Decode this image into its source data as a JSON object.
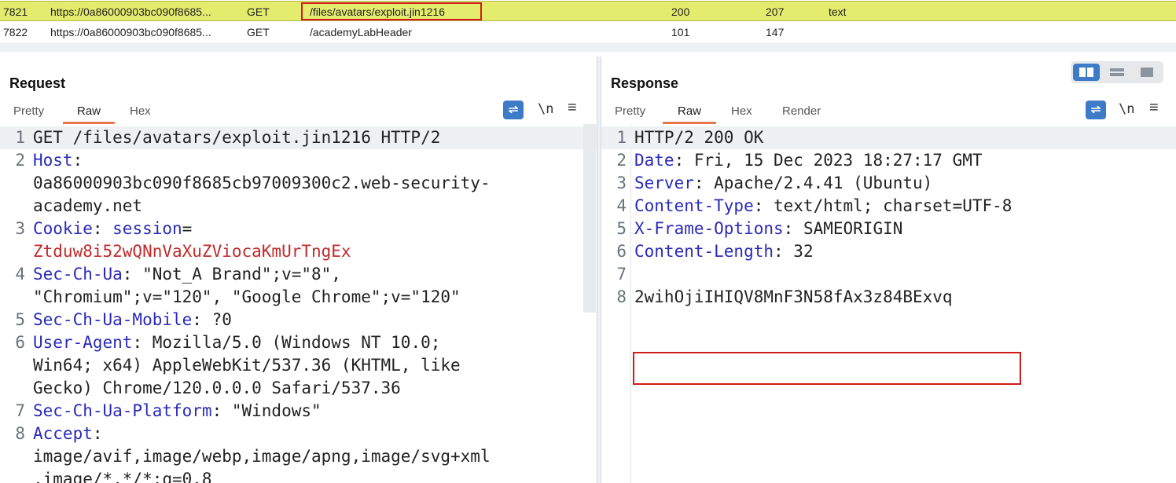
{
  "history": {
    "rows": [
      {
        "id": "7821",
        "url": "https://0a86000903bc090f8685...",
        "method": "GET",
        "path": "/files/avatars/exploit.jin1216",
        "status": "200",
        "length": "207",
        "mime": "text"
      },
      {
        "id": "7822",
        "url": "https://0a86000903bc090f8685...",
        "method": "GET",
        "path": "/academyLabHeader",
        "status": "101",
        "length": "147",
        "mime": ""
      }
    ],
    "highlight_color": "#e3ec6c"
  },
  "request": {
    "title": "Request",
    "tabs": [
      "Pretty",
      "Raw",
      "Hex"
    ],
    "active_tab": "Raw",
    "newline_label": "\\n",
    "lines": [
      {
        "n": "1",
        "parts": [
          [
            "t",
            "GET /files/avatars/exploit.jin1216 HTTP/2"
          ]
        ]
      },
      {
        "n": "2",
        "parts": [
          [
            "k",
            "Host"
          ],
          [
            "t",
            ":"
          ]
        ]
      },
      {
        "n": "",
        "parts": [
          [
            "t",
            "0a86000903bc090f8685cb97009300c2.web-security-"
          ]
        ]
      },
      {
        "n": "",
        "parts": [
          [
            "t",
            "academy.net"
          ]
        ]
      },
      {
        "n": "3",
        "parts": [
          [
            "k",
            "Cookie"
          ],
          [
            "t",
            ": "
          ],
          [
            "k",
            "session"
          ],
          [
            "t",
            "="
          ]
        ]
      },
      {
        "n": "",
        "parts": [
          [
            "v",
            "Ztduw8i52wQNnVaXuZViocaKmUrTngEx"
          ]
        ]
      },
      {
        "n": "4",
        "parts": [
          [
            "k",
            "Sec-Ch-Ua"
          ],
          [
            "t",
            ": \"Not_A Brand\";v=\"8\","
          ]
        ]
      },
      {
        "n": "",
        "parts": [
          [
            "t",
            "\"Chromium\";v=\"120\", \"Google Chrome\";v=\"120\""
          ]
        ]
      },
      {
        "n": "5",
        "parts": [
          [
            "k",
            "Sec-Ch-Ua-Mobile"
          ],
          [
            "t",
            ": ?0"
          ]
        ]
      },
      {
        "n": "6",
        "parts": [
          [
            "k",
            "User-Agent"
          ],
          [
            "t",
            ": Mozilla/5.0 (Windows NT 10.0;"
          ]
        ]
      },
      {
        "n": "",
        "parts": [
          [
            "t",
            "Win64; x64) AppleWebKit/537.36 (KHTML, like"
          ]
        ]
      },
      {
        "n": "",
        "parts": [
          [
            "t",
            "Gecko) Chrome/120.0.0.0 Safari/537.36"
          ]
        ]
      },
      {
        "n": "7",
        "parts": [
          [
            "k",
            "Sec-Ch-Ua-Platform"
          ],
          [
            "t",
            ": \"Windows\""
          ]
        ]
      },
      {
        "n": "8",
        "parts": [
          [
            "k",
            "Accept"
          ],
          [
            "t",
            ":"
          ]
        ]
      },
      {
        "n": "",
        "parts": [
          [
            "t",
            "image/avif,image/webp,image/apng,image/svg+xml"
          ]
        ]
      },
      {
        "n": "",
        "parts": [
          [
            "t",
            ",image/*,*/*;q=0.8"
          ]
        ]
      }
    ]
  },
  "response": {
    "title": "Response",
    "tabs": [
      "Pretty",
      "Raw",
      "Hex",
      "Render"
    ],
    "active_tab": "Raw",
    "newline_label": "\\n",
    "lines": [
      {
        "n": "1",
        "parts": [
          [
            "t",
            "HTTP/2 200 OK"
          ]
        ]
      },
      {
        "n": "2",
        "parts": [
          [
            "k",
            "Date"
          ],
          [
            "t",
            ": Fri, 15 Dec 2023 18:27:17 GMT"
          ]
        ]
      },
      {
        "n": "3",
        "parts": [
          [
            "k",
            "Server"
          ],
          [
            "t",
            ": Apache/2.4.41 (Ubuntu)"
          ]
        ]
      },
      {
        "n": "4",
        "parts": [
          [
            "k",
            "Content-Type"
          ],
          [
            "t",
            ": text/html; charset=UTF-8"
          ]
        ]
      },
      {
        "n": "5",
        "parts": [
          [
            "k",
            "X-Frame-Options"
          ],
          [
            "t",
            ": SAMEORIGIN"
          ]
        ]
      },
      {
        "n": "6",
        "parts": [
          [
            "k",
            "Content-Length"
          ],
          [
            "t",
            ": 32"
          ]
        ]
      },
      {
        "n": "7",
        "parts": [
          [
            "t",
            ""
          ]
        ]
      },
      {
        "n": "8",
        "parts": [
          [
            "t",
            "2wihOjiIHIQV8MnF3N58fAx3z84BExvq"
          ]
        ]
      }
    ]
  },
  "colors": {
    "accent": "#3d7ac7",
    "tab_underline": "#e8774a",
    "key": "#2a2ab8",
    "value": "#c02a2a",
    "highlight_box": "#d11a1a"
  }
}
